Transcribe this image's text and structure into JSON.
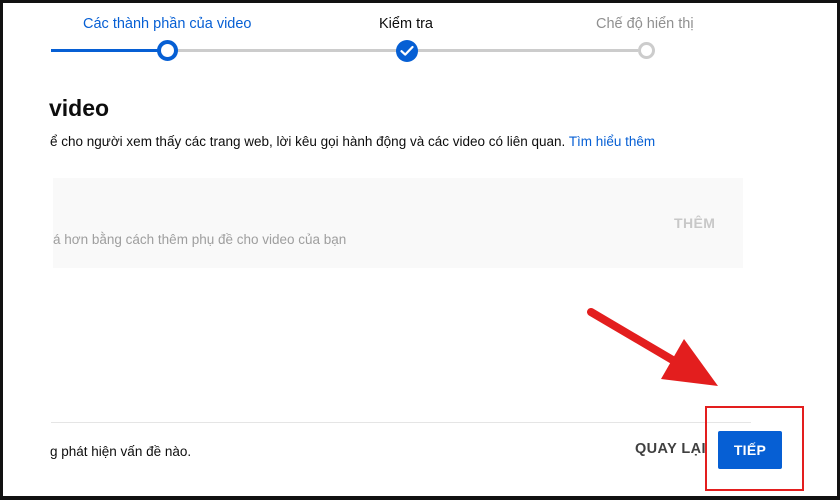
{
  "stepper": {
    "steps": [
      {
        "label": "Các thành phần của video",
        "state": "current"
      },
      {
        "label": "Kiểm tra",
        "state": "done"
      },
      {
        "label": "Chế độ hiển thị",
        "state": "todo"
      }
    ]
  },
  "section": {
    "title": " video",
    "description": "ể cho người xem thấy các trang web, lời kêu gọi hành động và các video có liên quan. ",
    "learn_more": "Tìm hiểu thêm"
  },
  "subtitles_card": {
    "hint": "á hơn bằng cách thêm phụ đề cho video của bạn",
    "add_label": "THÊM"
  },
  "footer": {
    "status": "g phát hiện vấn đề nào.",
    "back_label": "QUAY LẠI",
    "next_label": "TIẾP"
  },
  "colors": {
    "accent": "#065fd4",
    "annotation": "#e31e1e"
  },
  "icons": {
    "done_step": "check-icon",
    "annotation": "arrow-annotation-icon"
  }
}
